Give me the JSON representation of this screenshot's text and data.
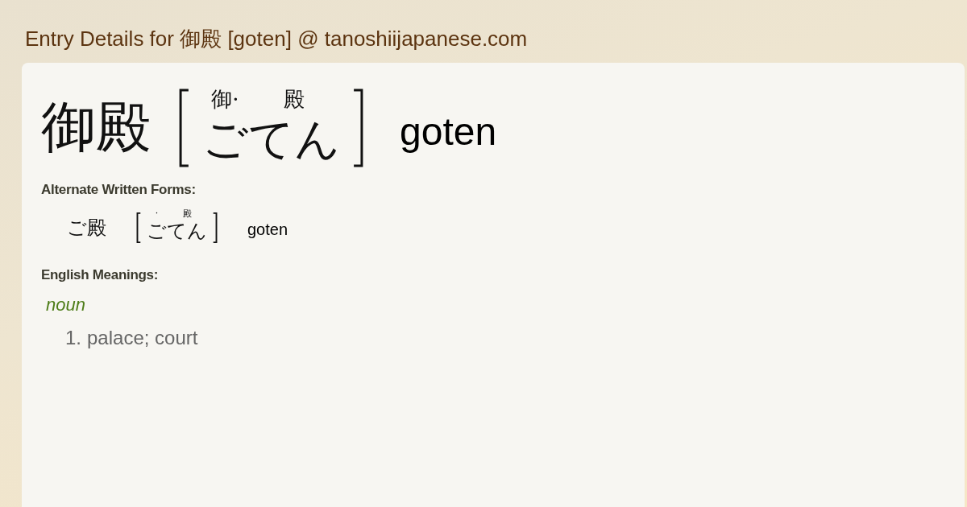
{
  "page_title": "Entry Details for 御殿 [goten] @ tanoshiijapanese.com",
  "entry": {
    "word": "御殿",
    "furigana": [
      {
        "ruby": "御·",
        "kana": "ご"
      },
      {
        "ruby": "殿",
        "kana": "てん"
      }
    ],
    "romaji": "goten"
  },
  "alternate_forms": {
    "heading": "Alternate Written Forms:",
    "items": [
      {
        "word": "ご殿",
        "furigana": [
          {
            "ruby": "·",
            "kana": "ご"
          },
          {
            "ruby": "殿",
            "kana": "てん"
          }
        ],
        "romaji": "goten"
      }
    ]
  },
  "meanings": {
    "heading": "English Meanings:",
    "groups": [
      {
        "pos": "noun",
        "senses": [
          {
            "number": "1.",
            "text": "palace; court"
          }
        ]
      }
    ]
  }
}
